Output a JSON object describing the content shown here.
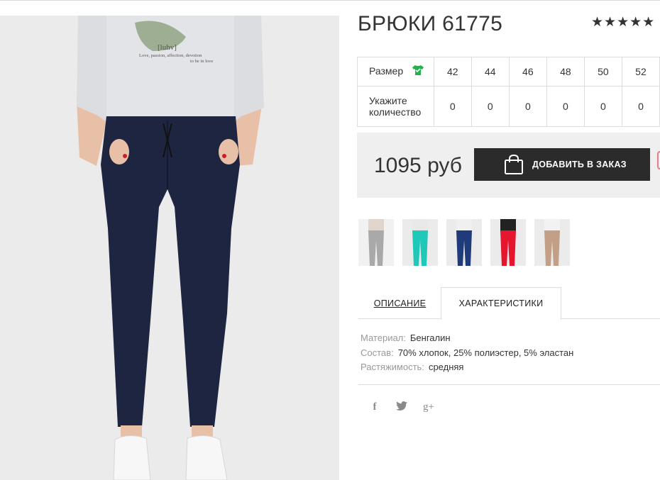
{
  "product": {
    "title": "БРЮКИ 61775",
    "rating_stars": "★★★★★",
    "price": "1095 руб",
    "add_button_label": "ДОБАВИТЬ В ЗАКАЗ"
  },
  "size_table": {
    "size_label": "Размер",
    "qty_label_line1": "Укажите",
    "qty_label_line2": "количество",
    "sizes": [
      "42",
      "44",
      "46",
      "48",
      "50",
      "52"
    ],
    "quantities": [
      "0",
      "0",
      "0",
      "0",
      "0",
      "0"
    ]
  },
  "photo": {
    "shirt_text_line1": "[luhv]",
    "shirt_text_line2": "Love, passion, affection, devotion",
    "shirt_text_line3": "to be in love"
  },
  "thumbnails": [
    {
      "color": "#a9a9a9"
    },
    {
      "color": "#1fc8b8"
    },
    {
      "color": "#1f3b7a"
    },
    {
      "color": "#e5172e"
    },
    {
      "color": "#c29f86"
    }
  ],
  "tabs": {
    "description": "ОПИСАНИЕ",
    "characteristics": "ХАРАКТЕРИСТИКИ"
  },
  "characteristics": [
    {
      "key": "Материал:",
      "value": "Бенгалин"
    },
    {
      "key": "Состав:",
      "value": "70% хлопок, 25% полиэстер, 5% эластан"
    },
    {
      "key": "Растяжимость:",
      "value": "средняя"
    }
  ],
  "social": {
    "facebook": "f",
    "twitter": "twitter-icon",
    "google": "g+"
  },
  "colors": {
    "accent_dark": "#2b2b2b",
    "price_bg": "#efefef",
    "size_icon_green": "#22b14c"
  }
}
